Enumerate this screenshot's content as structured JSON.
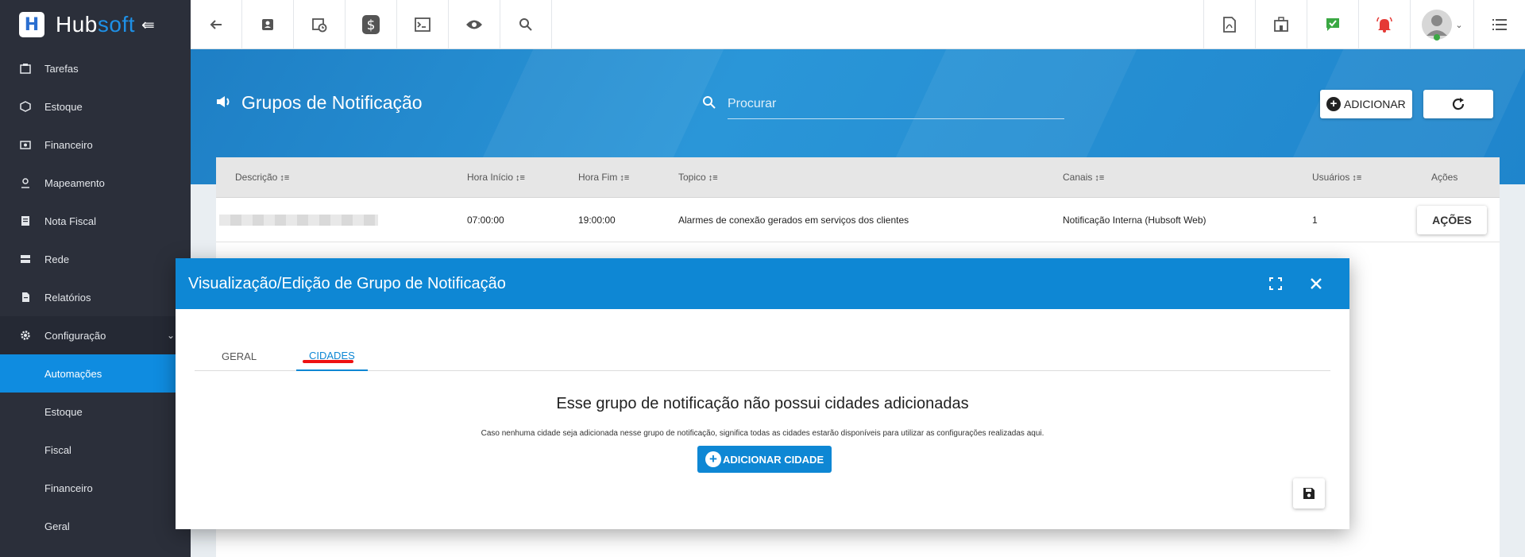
{
  "app": {
    "name_part1": "Hub",
    "name_part2": "soft",
    "logo_letter": "H"
  },
  "sidebar": {
    "items": [
      {
        "label": "Tarefas",
        "icon": "tasks-icon"
      },
      {
        "label": "Estoque",
        "icon": "box-icon"
      },
      {
        "label": "Financeiro",
        "icon": "money-icon"
      },
      {
        "label": "Mapeamento",
        "icon": "map-pin-icon"
      },
      {
        "label": "Nota Fiscal",
        "icon": "invoice-icon"
      },
      {
        "label": "Rede",
        "icon": "server-icon"
      },
      {
        "label": "Relatórios",
        "icon": "report-icon"
      },
      {
        "label": "Configuração",
        "icon": "gear-icon"
      }
    ],
    "subitems": [
      {
        "label": "Automações",
        "active": true
      },
      {
        "label": "Estoque"
      },
      {
        "label": "Fiscal"
      },
      {
        "label": "Financeiro"
      },
      {
        "label": "Geral"
      }
    ]
  },
  "page": {
    "title": "Grupos de Notificação",
    "search_placeholder": "Procurar",
    "add_label": "ADICIONAR"
  },
  "table": {
    "headers": [
      "Descrição",
      "Hora Início",
      "Hora Fim",
      "Topico",
      "Canais",
      "Usuários",
      "Ações"
    ],
    "rows": [
      {
        "descricao": "",
        "hora_inicio": "07:00:00",
        "hora_fim": "19:00:00",
        "topico": "Alarmes de conexão gerados em serviços dos clientes",
        "canais": "Notificação Interna (Hubsoft Web)",
        "usuarios": "1",
        "acoes": "AÇÕES"
      }
    ]
  },
  "modal": {
    "title": "Visualização/Edição de Grupo de Notificação",
    "tabs": [
      "GERAL",
      "CIDADES"
    ],
    "active_tab": "CIDADES",
    "empty_title": "Esse grupo de notificação não possui cidades adicionadas",
    "empty_desc": "Caso nenhuma cidade seja adicionada nesse grupo de notificação, significa todas as cidades estarão disponíveis para utilizar as configurações realizadas aqui.",
    "add_city_label": "ADICIONAR CIDADE"
  },
  "colors": {
    "primary": "#0e87d4",
    "sidebar_bg": "#2b2f3a",
    "active_item": "#0f8ce0",
    "tab_marker": "#e11111"
  }
}
